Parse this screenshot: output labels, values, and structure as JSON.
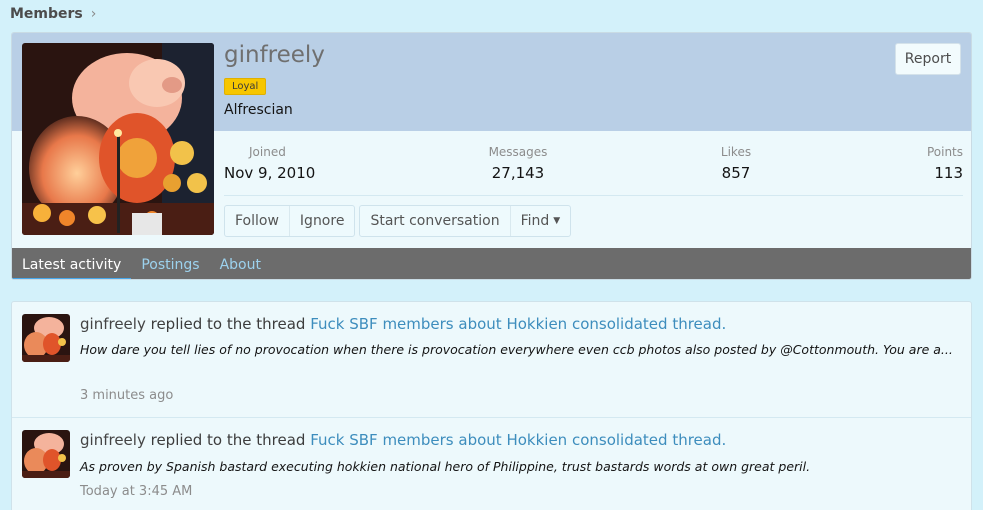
{
  "breadcrumb": {
    "members_label": "Members",
    "chevron": "›"
  },
  "profile": {
    "username": "ginfreely",
    "badge": "Loyal",
    "user_title": "Alfrescian",
    "report_label": "Report",
    "stats": {
      "joined_label": "Joined",
      "joined_value": "Nov 9, 2010",
      "messages_label": "Messages",
      "messages_value": "27,143",
      "likes_label": "Likes",
      "likes_value": "857",
      "points_label": "Points",
      "points_value": "113"
    },
    "actions": {
      "follow": "Follow",
      "ignore": "Ignore",
      "start_conversation": "Start conversation",
      "find": "Find"
    }
  },
  "tabs": [
    {
      "label": "Latest activity"
    },
    {
      "label": "Postings"
    },
    {
      "label": "About"
    }
  ],
  "activity": [
    {
      "user": "ginfreely",
      "action": "replied to the thread",
      "thread": "Fuck SBF members about Hokkien consolidated thread.",
      "snippet": "How dare you tell lies of no provocation when there is provocation everywhere even ccb photos also posted by @Cottonmouth. You are a...",
      "time": "3 minutes ago"
    },
    {
      "user": "ginfreely",
      "action": "replied to the thread",
      "thread": "Fuck SBF members about Hokkien consolidated thread.",
      "snippet": "As proven by Spanish bastard executing hokkien national hero of Philippine, trust bastards words at own great peril.",
      "time": "Today at 3:45 AM"
    }
  ],
  "colors": {
    "page_bg": "#d3f1fa",
    "header_bg": "#b9cfe6",
    "tab_bar": "#6c6c6c",
    "tab_active_underline": "#47a7eb",
    "link": "#3d8dbd",
    "badge": "#f7c600"
  }
}
